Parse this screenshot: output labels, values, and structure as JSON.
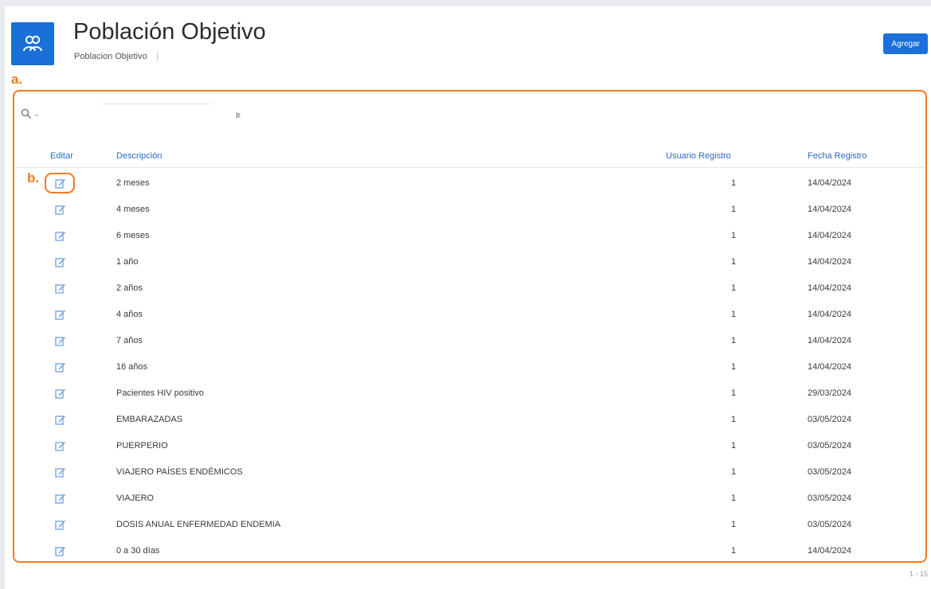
{
  "header": {
    "title": "Población Objetivo",
    "breadcrumb": "Poblacion Objetivo",
    "add_button": "Agregar",
    "app_icon": "users-icon"
  },
  "annotations": {
    "frame_marker": "a.",
    "edit_marker": "b."
  },
  "toolbar": {
    "search_value": "",
    "go_label": "Ir",
    "search_icon": "search-icon"
  },
  "table": {
    "columns": [
      "Editar",
      "Descripción",
      "Usuario Registro",
      "Fecha Registro"
    ],
    "rows": [
      {
        "descripcion": "2 meses",
        "usuario": "1",
        "fecha": "14/04/2024"
      },
      {
        "descripcion": "4 meses",
        "usuario": "1",
        "fecha": "14/04/2024"
      },
      {
        "descripcion": "6 meses",
        "usuario": "1",
        "fecha": "14/04/2024"
      },
      {
        "descripcion": "1 año",
        "usuario": "1",
        "fecha": "14/04/2024"
      },
      {
        "descripcion": "2 años",
        "usuario": "1",
        "fecha": "14/04/2024"
      },
      {
        "descripcion": "4 años",
        "usuario": "1",
        "fecha": "14/04/2024"
      },
      {
        "descripcion": "7 años",
        "usuario": "1",
        "fecha": "14/04/2024"
      },
      {
        "descripcion": "16 años",
        "usuario": "1",
        "fecha": "14/04/2024"
      },
      {
        "descripcion": "Pacientes HIV positivo",
        "usuario": "1",
        "fecha": "29/03/2024"
      },
      {
        "descripcion": "EMBARAZADAS",
        "usuario": "1",
        "fecha": "03/05/2024"
      },
      {
        "descripcion": "PUERPERIO",
        "usuario": "1",
        "fecha": "03/05/2024"
      },
      {
        "descripcion": "VIAJERO PAÍSES ENDÉMICOS",
        "usuario": "1",
        "fecha": "03/05/2024"
      },
      {
        "descripcion": "VIAJERO",
        "usuario": "1",
        "fecha": "03/05/2024"
      },
      {
        "descripcion": "DOSIS ANUAL ENFERMEDAD ENDEMIA",
        "usuario": "1",
        "fecha": "03/05/2024"
      },
      {
        "descripcion": "0 a 30 días",
        "usuario": "1",
        "fecha": "14/04/2024"
      }
    ]
  },
  "pagination": "1 - 15",
  "colors": {
    "accent": "#1a6fd8",
    "header_text": "#2a6bbf",
    "annotation": "#f47a1f"
  }
}
